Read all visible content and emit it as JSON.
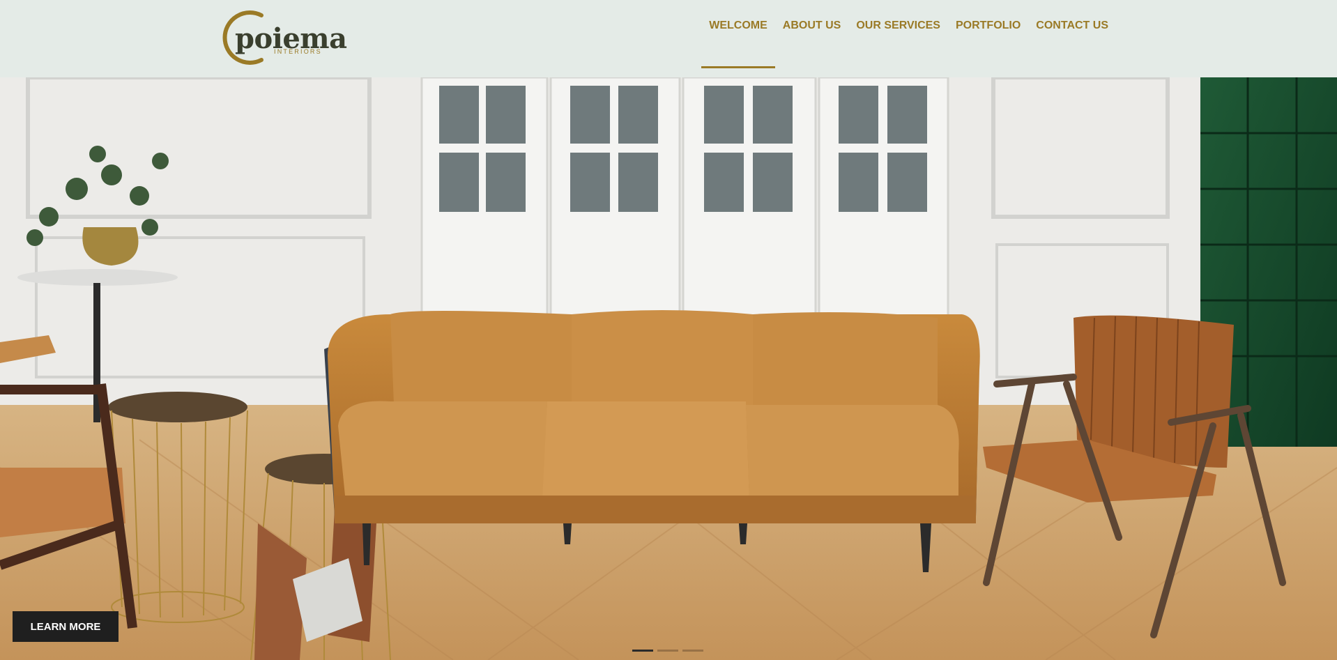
{
  "brand": {
    "name": "poiema",
    "tagline": "INTERIORS",
    "gold": "#9a7a26",
    "dark": "#3a3f2e"
  },
  "nav": {
    "items": [
      {
        "label": "WELCOME",
        "active": true
      },
      {
        "label": "ABOUT US",
        "active": false
      },
      {
        "label": "OUR SERVICES",
        "active": false
      },
      {
        "label": "PORTFOLIO",
        "active": false
      },
      {
        "label": "CONTACT US",
        "active": false
      }
    ]
  },
  "hero": {
    "cta_label": "LEARN MORE",
    "slides": 3,
    "active_slide": 1
  },
  "colors": {
    "header_bg": "#e4ebe7",
    "accent": "#9a7a26",
    "cta_bg": "#1f1f1f"
  }
}
